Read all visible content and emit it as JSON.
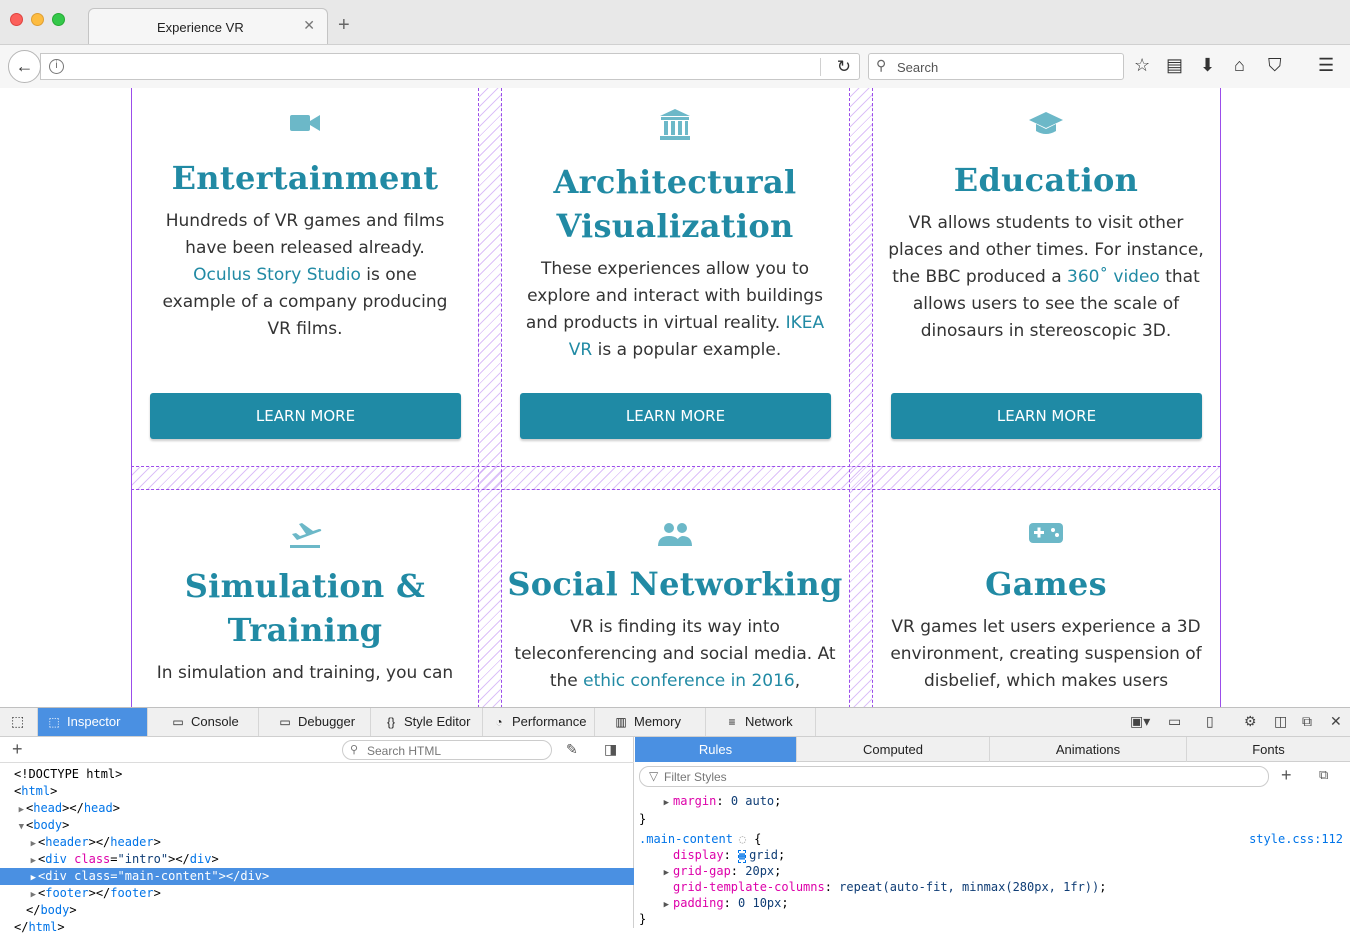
{
  "browser": {
    "tab_title": "Experience VR",
    "tab_close": "✕",
    "new_tab": "+",
    "search_placeholder": "Search"
  },
  "cards": [
    {
      "title_lines": [
        "Entertainment"
      ],
      "text_before": "Hundreds of VR games and films have been released already. ",
      "link": "Oculus Story Studio",
      "text_after": " is one example of a company producing VR films.",
      "button": "LEARN MORE",
      "icon": "video-camera-icon"
    },
    {
      "title_lines": [
        "Architectural",
        "Visualization"
      ],
      "text_before": "These experiences allow you to explore and interact with buildings and products in virtual reality. ",
      "link": "IKEA VR",
      "text_after": " is a popular example.",
      "button": "LEARN MORE",
      "icon": "building-icon"
    },
    {
      "title_lines": [
        "Education"
      ],
      "text_before": "VR allows students to visit other places and other times. For instance, the BBC produced a ",
      "link": "360˚ video",
      "text_after": " that allows users to see the scale of dinosaurs in stereoscopic 3D.",
      "button": "LEARN MORE",
      "icon": "graduation-cap-icon"
    },
    {
      "title_lines": [
        "Simulation &",
        "Training"
      ],
      "text_before": "In simulation and training, you can",
      "link": "",
      "text_after": "",
      "button": "",
      "icon": "airplane-icon"
    },
    {
      "title_lines": [
        "Social Networking"
      ],
      "text_before": "VR is finding its way into teleconferencing and social media. At the ",
      "link": "ethic conference in 2016",
      "text_after": ",",
      "button": "",
      "icon": "people-icon"
    },
    {
      "title_lines": [
        "Games"
      ],
      "text_before": "VR games let users experience a 3D environment, creating suspension of disbelief, which makes users",
      "link": "",
      "text_after": "",
      "button": "",
      "icon": "gamepad-icon"
    }
  ],
  "devtools": {
    "tabs": [
      "Inspector",
      "Console",
      "Debugger",
      "Style Editor",
      "Performance",
      "Memory",
      "Network"
    ],
    "active_tab": "Inspector",
    "search_html_placeholder": "Search HTML",
    "html_tree": [
      {
        "indent": 0,
        "arrow": "",
        "parts": [
          [
            "plain",
            "<!DOCTYPE html>"
          ]
        ]
      },
      {
        "indent": 0,
        "arrow": "",
        "parts": [
          [
            "plain",
            "<"
          ],
          [
            "tag",
            "html"
          ],
          [
            "plain",
            ">"
          ]
        ]
      },
      {
        "indent": 1,
        "arrow": "▶",
        "parts": [
          [
            "plain",
            "<"
          ],
          [
            "tag",
            "head"
          ],
          [
            "plain",
            "></"
          ],
          [
            "tag",
            "head"
          ],
          [
            "plain",
            ">"
          ]
        ]
      },
      {
        "indent": 1,
        "arrow": "▼",
        "parts": [
          [
            "plain",
            "<"
          ],
          [
            "tag",
            "body"
          ],
          [
            "plain",
            ">"
          ]
        ]
      },
      {
        "indent": 2,
        "arrow": "▶",
        "parts": [
          [
            "plain",
            "<"
          ],
          [
            "tag",
            "header"
          ],
          [
            "plain",
            "></"
          ],
          [
            "tag",
            "header"
          ],
          [
            "plain",
            ">"
          ]
        ]
      },
      {
        "indent": 2,
        "arrow": "▶",
        "parts": [
          [
            "plain",
            "<"
          ],
          [
            "tag",
            "div"
          ],
          [
            "plain",
            " "
          ],
          [
            "attr",
            "class"
          ],
          [
            "plain",
            "="
          ],
          [
            "val",
            "\"intro\""
          ],
          [
            "plain",
            "></"
          ],
          [
            "tag",
            "div"
          ],
          [
            "plain",
            ">"
          ]
        ]
      },
      {
        "indent": 2,
        "arrow": "▶",
        "selected": true,
        "parts": [
          [
            "plain",
            "<"
          ],
          [
            "tag",
            "div"
          ],
          [
            "plain",
            " "
          ],
          [
            "attr",
            "class"
          ],
          [
            "plain",
            "="
          ],
          [
            "val",
            "\"main-content\""
          ],
          [
            "plain",
            "></"
          ],
          [
            "tag",
            "div"
          ],
          [
            "plain",
            ">"
          ]
        ]
      },
      {
        "indent": 2,
        "arrow": "▶",
        "parts": [
          [
            "plain",
            "<"
          ],
          [
            "tag",
            "footer"
          ],
          [
            "plain",
            "></"
          ],
          [
            "tag",
            "footer"
          ],
          [
            "plain",
            ">"
          ]
        ]
      },
      {
        "indent": 1,
        "arrow": "",
        "parts": [
          [
            "plain",
            "</"
          ],
          [
            "tag",
            "body"
          ],
          [
            "plain",
            ">"
          ]
        ]
      },
      {
        "indent": 0,
        "arrow": "",
        "parts": [
          [
            "plain",
            "</"
          ],
          [
            "tag",
            "html"
          ],
          [
            "plain",
            ">"
          ]
        ]
      }
    ],
    "css_tabs": [
      "Rules",
      "Computed",
      "Animations",
      "Fonts"
    ],
    "active_css_tab": "Rules",
    "filter_placeholder": "Filter Styles",
    "rules": [
      {
        "text": "  ▶ margin: 0 auto;",
        "kind": "prop",
        "prop": "margin",
        "value": "0 auto"
      },
      {
        "text": "}",
        "kind": "brace"
      },
      {
        "text": ".main-content",
        "kind": "selector",
        "source": "style.css:112"
      },
      {
        "kind": "prop",
        "prop": "display",
        "value": "grid"
      },
      {
        "kind": "prop",
        "prop": "grid-gap",
        "value": "20px",
        "arrow": true
      },
      {
        "kind": "prop",
        "prop": "grid-template-columns",
        "value": "repeat(auto-fit, minmax(280px, 1fr))"
      },
      {
        "kind": "prop",
        "prop": "padding",
        "value": "0 10px",
        "arrow": true
      },
      {
        "text": "}",
        "kind": "brace"
      }
    ]
  }
}
